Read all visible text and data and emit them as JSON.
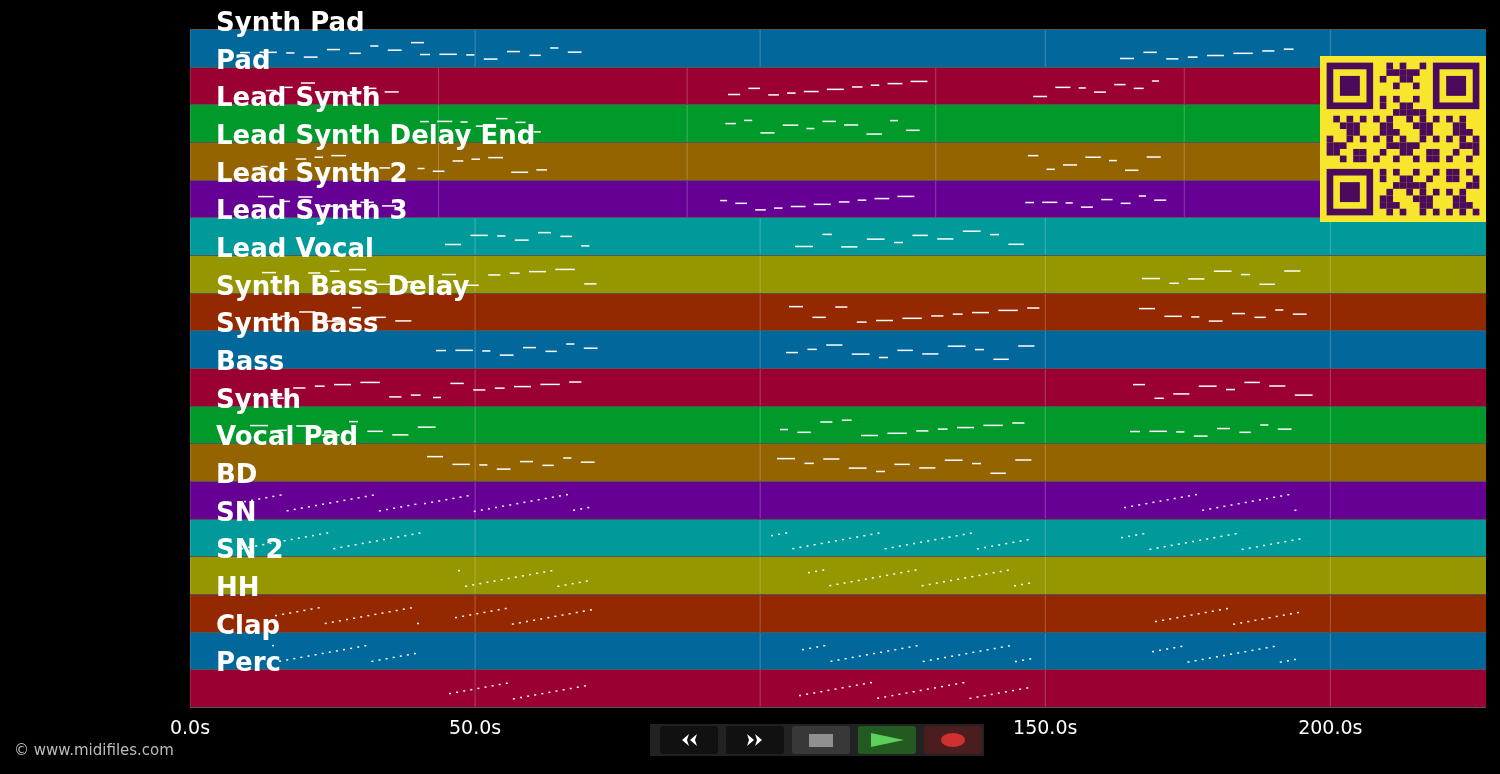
{
  "tracks": [
    {
      "name": "Synth Pad",
      "color": "#02679a"
    },
    {
      "name": "Pad",
      "color": "#9a0032"
    },
    {
      "name": "Lead Synth",
      "color": "#009a2a"
    },
    {
      "name": "Lead Synth Delay End",
      "color": "#946400"
    },
    {
      "name": "Lead Synth 2",
      "color": "#660094"
    },
    {
      "name": "Lead Synth 3",
      "color": "#009a9a"
    },
    {
      "name": "Lead Vocal",
      "color": "#969600"
    },
    {
      "name": "Synth Bass Delay",
      "color": "#942800"
    },
    {
      "name": "Synth Bass",
      "color": "#02679a"
    },
    {
      "name": "Bass",
      "color": "#9a0032"
    },
    {
      "name": "Synth",
      "color": "#009a2a"
    },
    {
      "name": "Vocal Pad",
      "color": "#946400"
    },
    {
      "name": "BD",
      "color": "#660094"
    },
    {
      "name": "SN",
      "color": "#009a9a"
    },
    {
      "name": "SN 2",
      "color": "#969600"
    },
    {
      "name": "HH",
      "color": "#942800"
    },
    {
      "name": "Clap",
      "color": "#02679a"
    },
    {
      "name": "Perc",
      "color": "#9a0032"
    }
  ],
  "time_axis": {
    "ticks": [
      "0.0s",
      "50.0s",
      "150.0s",
      "200.0s"
    ]
  },
  "transport": [
    {
      "kind": "rewind"
    },
    {
      "kind": "forward"
    },
    {
      "kind": "stop"
    },
    {
      "kind": "play"
    },
    {
      "kind": "record"
    }
  ],
  "copyright": "© www.midifiles.com"
}
